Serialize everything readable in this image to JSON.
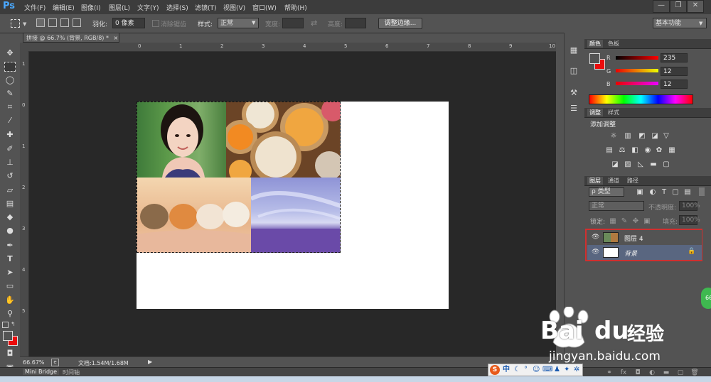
{
  "app": {
    "logo": "Ps"
  },
  "menu": [
    "文件(F)",
    "编辑(E)",
    "图像(I)",
    "图层(L)",
    "文字(Y)",
    "选择(S)",
    "滤镜(T)",
    "视图(V)",
    "窗口(W)",
    "帮助(H)"
  ],
  "window_controls": {
    "minimize": "—",
    "restore": "❐",
    "close": "✕"
  },
  "options": {
    "feather_label": "羽化:",
    "feather_value": "0 像素",
    "antialias_label": "消除锯齿",
    "style_label": "样式:",
    "style_value": "正常",
    "width_label": "宽度:",
    "height_label": "高度:",
    "refine_edge": "调整边缘...",
    "workspace": "基本功能"
  },
  "document": {
    "tab_title": "拼接 @ 66.7% (背景, RGB/8) *",
    "close": "×"
  },
  "ruler_top_ticks": [
    "0",
    "1",
    "2",
    "3",
    "4",
    "5",
    "6",
    "7",
    "8",
    "9",
    "10"
  ],
  "ruler_left_ticks": [
    "1",
    "0",
    "1",
    "2",
    "3",
    "4",
    "5"
  ],
  "status": {
    "zoom": "66.67%",
    "doc_info": "文档:1.54M/1.68M"
  },
  "bottom_tabs": [
    "Mini Bridge",
    "时间轴"
  ],
  "color_panel": {
    "tabs": [
      "颜色",
      "色板"
    ],
    "channels": [
      {
        "label": "R",
        "value": "235"
      },
      {
        "label": "G",
        "value": "12"
      },
      {
        "label": "B",
        "value": "12"
      }
    ],
    "foreground": "#eb0c0c"
  },
  "adjust_panel": {
    "tabs": [
      "调整",
      "样式"
    ],
    "title": "添加调整"
  },
  "layers_panel": {
    "tabs": [
      "图层",
      "通道",
      "路径"
    ],
    "filter_label": "ρ 类型",
    "blend_mode": "正常",
    "opacity_label": "不透明度:",
    "opacity_value": "100%",
    "lock_label": "锁定:",
    "fill_label": "填充:",
    "fill_value": "100%",
    "layers": [
      {
        "name": "图层 4"
      },
      {
        "name": "背景"
      }
    ]
  },
  "watermark": {
    "brand": "Bai",
    "brand2": "du",
    "cn": "经验",
    "url": "jingyan.baidu.com"
  },
  "badge": "66",
  "ime": {
    "mode": "中"
  },
  "colors": {
    "accent_blue": "#4aa8ff",
    "foreground_red": "#eb0c0c",
    "layer_highlight": "#d03030"
  }
}
